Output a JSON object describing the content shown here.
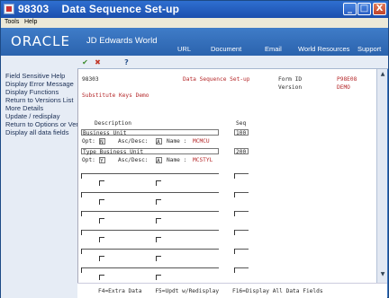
{
  "window": {
    "title": "98303    Data Sequence Set-up",
    "controls": [
      "_",
      "□",
      "X"
    ]
  },
  "menubar": {
    "items": [
      "Tools",
      "Help"
    ]
  },
  "banner": {
    "logo": "ORACLE",
    "product": "JD Edwards World",
    "nav": [
      "URL",
      "Document",
      "Email",
      "World Resources",
      "Support"
    ]
  },
  "toolbar": {
    "ok": "✔",
    "cancel": "✖",
    "help": "?"
  },
  "exits": [
    "Field Sensitive Help",
    "Display Error Message",
    "Display Functions",
    "Return to Versions List",
    "More Details",
    "Update / redisplay",
    "Return to Options or Ver",
    "Display all data fields"
  ],
  "form": {
    "program": "98303",
    "screen_title": "Data Sequence Set-up",
    "form_id_label": "Form ID",
    "form_id": "P98E08",
    "version_label": "Version",
    "version": "DEMO",
    "subtitle": "Substitute Keys Demo",
    "col_description": "Description",
    "col_seq": "Seq",
    "opt_label": "Opt:",
    "ascdesc_label": "Asc/Desc:",
    "name_label": "Name :",
    "rows": [
      {
        "description": "Business Unit",
        "opt": "N",
        "ascdesc": "A",
        "name": "MCMCU",
        "seq": "100"
      },
      {
        "description": "Type Business Unit",
        "opt": "Y",
        "ascdesc": "A",
        "name": "MCSTYL",
        "seq": "200"
      }
    ]
  },
  "fkeys": "F4=Extra Data    F5=Updt w/Redisplay    F16=Display All Data Fields",
  "colors": {
    "banner": "#2b63ad",
    "panel": "#e6ecf5",
    "accent_red": "#b5282a"
  }
}
